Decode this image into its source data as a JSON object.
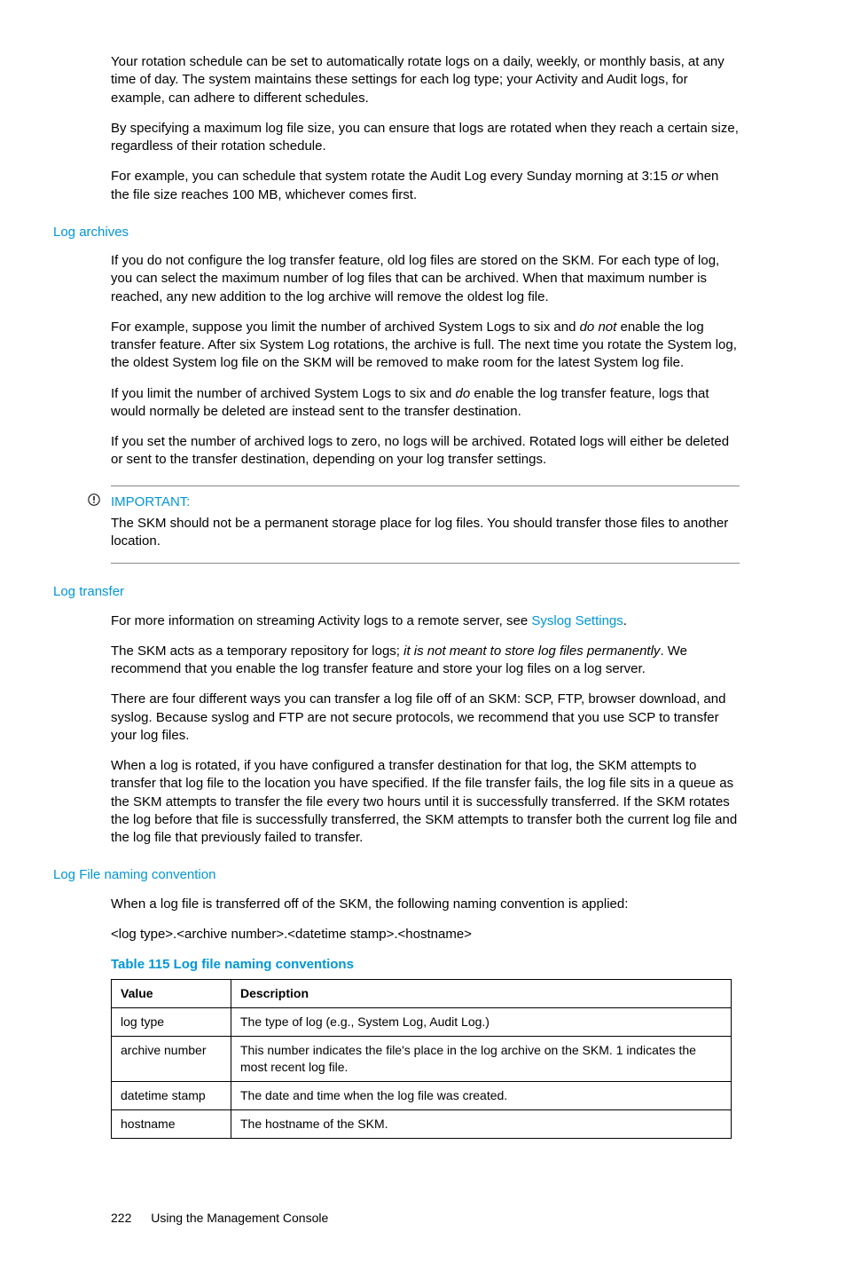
{
  "intro": {
    "p1_a": "Your rotation schedule can be set to automatically rotate logs on a daily, weekly, or monthly basis, at any time of day. The system maintains these settings for each log type; your Activity and Audit logs, for example, can adhere to different schedules.",
    "p2_a": "By specifying a maximum log file size, you can ensure that logs are rotated when they reach a certain size, regardless of their rotation schedule.",
    "p3_a": "For example, you can schedule that system rotate the Audit Log every Sunday morning at 3:15 ",
    "p3_em": "or",
    "p3_b": " when the file size reaches 100 MB, whichever comes first."
  },
  "archives": {
    "head": "Log archives",
    "p1": "If you do not configure the log transfer feature, old log files are stored on the SKM. For each type of log, you can select the maximum number of log files that can be archived. When that maximum number is reached, any new addition to the log archive will remove the oldest log file.",
    "p2_a": "For example, suppose you limit the number of archived System Logs to six and ",
    "p2_em": "do not",
    "p2_b": " enable the log transfer feature. After six System Log rotations, the archive is full. The next time you rotate the System log, the oldest System log file on the SKM will be removed to make room for the latest System log file.",
    "p3_a": "If you limit the number of archived System Logs to six and ",
    "p3_em": "do",
    "p3_b": " enable the log transfer feature, logs that would normally be deleted are instead sent to the transfer destination.",
    "p4": "If you set the number of archived logs to zero, no logs will be archived. Rotated logs will either be deleted or sent to the transfer destination, depending on your log transfer settings."
  },
  "note": {
    "head": "IMPORTANT:",
    "body": "The SKM should not be a permanent storage place for log files. You should transfer those files to another location."
  },
  "transfer": {
    "head": "Log transfer",
    "p1_a": "For more information on streaming Activity logs to a remote server, see ",
    "p1_link": "Syslog Settings",
    "p1_b": ".",
    "p2_a": "The SKM acts as a temporary repository for logs; ",
    "p2_em": "it is not meant to store log files permanently",
    "p2_b": ". We recommend that you enable the log transfer feature and store your log files on a log server.",
    "p3": "There are four different ways you can transfer a log file off of an SKM: SCP, FTP, browser download, and syslog. Because syslog and FTP are not secure protocols, we recommend that you use SCP to transfer your log files.",
    "p4": "When a log is rotated, if you have configured a transfer destination for that log, the SKM attempts to transfer that log file to the location you have specified. If the file transfer fails, the log file sits in a queue as the SKM attempts to transfer the file every two hours until it is successfully transferred. If the SKM rotates the log before that file is successfully transferred, the SKM attempts to transfer both the current log file and the log file that previously failed to transfer."
  },
  "naming": {
    "head": "Log File naming convention",
    "p1": "When a log file is transferred off of the SKM, the following naming convention is applied:",
    "p2": "<log type>.<archive number>.<datetime stamp>.<hostname>",
    "tbl_title": "Table 115 Log file naming conventions",
    "cols": {
      "c1": "Value",
      "c2": "Description"
    },
    "rows": [
      {
        "v": "log type",
        "d": "The type of log (e.g., System Log, Audit Log.)"
      },
      {
        "v": "archive number",
        "d": "This number indicates the file's place in the log archive on the SKM. 1 indicates the most recent log file."
      },
      {
        "v": "datetime stamp",
        "d": "The date and time when the log file was created."
      },
      {
        "v": "hostname",
        "d": "The hostname of the SKM."
      }
    ]
  },
  "footer": {
    "page": "222",
    "title": "Using the Management Console"
  }
}
